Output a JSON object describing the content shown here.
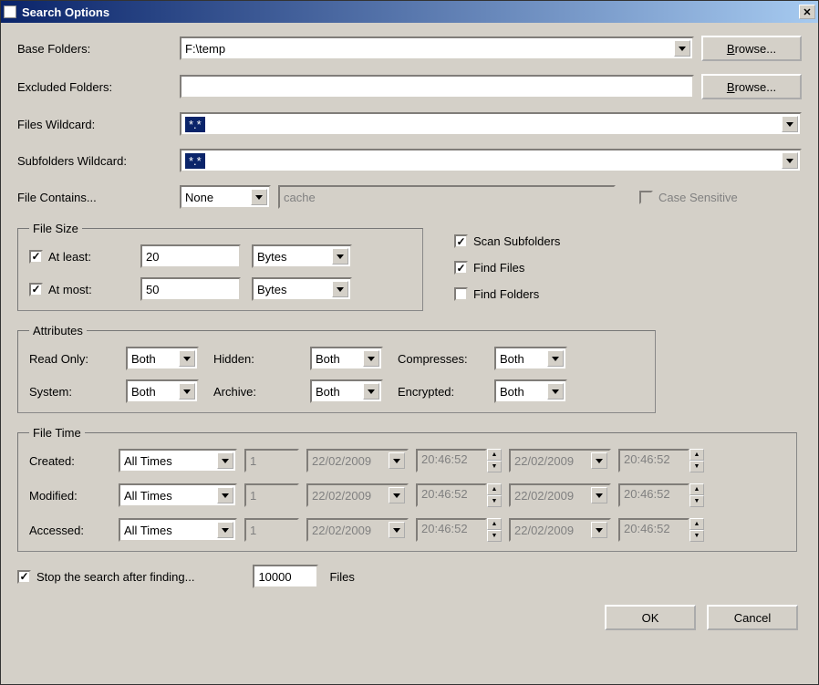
{
  "title": "Search Options",
  "labels": {
    "baseFolders": "Base Folders:",
    "excludedFolders": "Excluded Folders:",
    "filesWildcard": "Files Wildcard:",
    "subfoldersWildcard": "Subfolders Wildcard:",
    "fileContains": "File Contains...",
    "caseSensitive": "Case Sensitive",
    "fileSize": "File Size",
    "atLeast": "At least:",
    "atMost": "At most:",
    "scanSubfolders": "Scan Subfolders",
    "findFiles": "Find Files",
    "findFolders": "Find Folders",
    "attributes": "Attributes",
    "readOnly": "Read Only:",
    "hidden": "Hidden:",
    "compresses": "Compresses:",
    "system": "System:",
    "archive": "Archive:",
    "encrypted": "Encrypted:",
    "fileTime": "File Time",
    "created": "Created:",
    "modified": "Modified:",
    "accessed": "Accessed:",
    "stopAfter": "Stop the search after finding...",
    "files": "Files"
  },
  "values": {
    "baseFolders": "F:\\temp",
    "excludedFolders": "",
    "filesWildcard": "*.*",
    "subfoldersWildcard": "*.*",
    "fileContainsMode": "None",
    "fileContainsText": "cache",
    "atLeastVal": "20",
    "atLeastUnit": "Bytes",
    "atMostVal": "50",
    "atMostUnit": "Bytes",
    "attrBoth": "Both",
    "timeMode": "All Times",
    "timeN": "1",
    "date": "22/02/2009",
    "time": "20:46:52",
    "stopAfter": "10000"
  },
  "checks": {
    "atLeast": true,
    "atMost": true,
    "scanSubfolders": true,
    "findFiles": true,
    "findFolders": false,
    "caseSensitive": false,
    "stopAfter": true
  },
  "buttons": {
    "browse": "Browse...",
    "ok": "OK",
    "cancel": "Cancel"
  }
}
